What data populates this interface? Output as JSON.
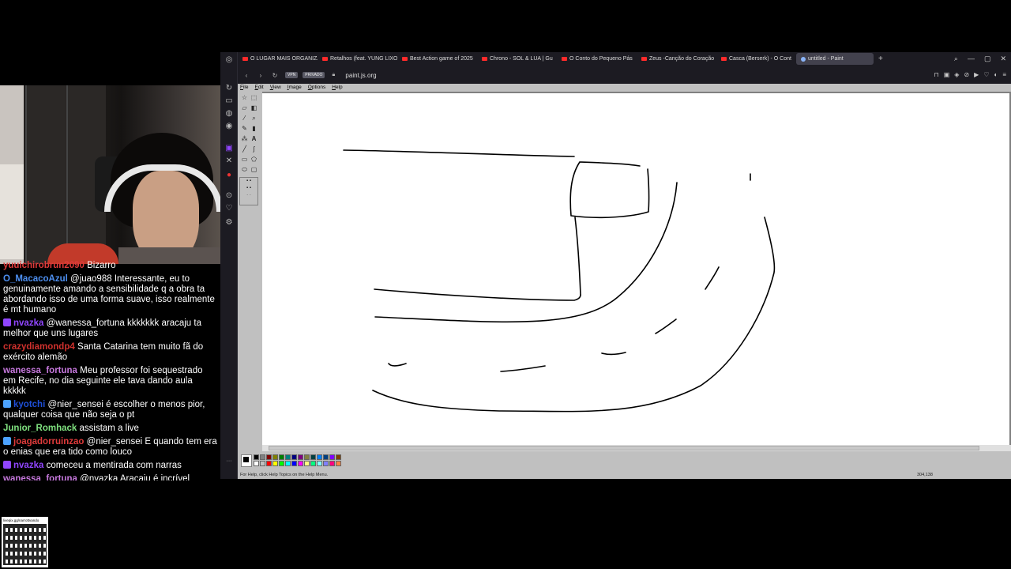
{
  "browser": {
    "tabs": [
      {
        "label": "O LUGAR MAIS ORGANIZA"
      },
      {
        "label": "Retalhos (feat. YUNG LIXO"
      },
      {
        "label": "Best Action game of 2025"
      },
      {
        "label": "Chrono - SOL & LUA | Gu"
      },
      {
        "label": "O Conto do Pequeno Pás"
      },
      {
        "label": "Zeus -Canção do Coração"
      },
      {
        "label": "Casca (Berserk) - O Cont"
      },
      {
        "label": "untitled - Paint"
      }
    ],
    "new_tab": "+",
    "vpn_label": "VPN",
    "private_label": "PRIVADO",
    "url": "paint.js.org"
  },
  "paint": {
    "menu": [
      "File",
      "Edit",
      "View",
      "Image",
      "Options",
      "Help"
    ],
    "status_text": "For Help, click Help Topics on the Help Menu.",
    "status_coords": "304,138",
    "palette": [
      "#000000",
      "#808080",
      "#800000",
      "#808000",
      "#008000",
      "#008080",
      "#000080",
      "#800080",
      "#808040",
      "#004040",
      "#0080ff",
      "#004080",
      "#8000ff",
      "#804000",
      "#ffffff",
      "#c0c0c0",
      "#ff0000",
      "#ffff00",
      "#00ff00",
      "#00ffff",
      "#0000ff",
      "#ff00ff",
      "#ffff80",
      "#00ff80",
      "#80ffff",
      "#8080ff",
      "#ff0080",
      "#ff8040"
    ]
  },
  "chat": {
    "messages": [
      {
        "user": "yuuichirobrun2090",
        "color": "#e03b3b",
        "text": "Bizarro",
        "badge": ""
      },
      {
        "user": "O_MacacoAzul",
        "color": "#4d8ff0",
        "text": "@juao988 Interessante, eu to genuinamente amando a sensibilidade q a obra ta abordando isso de uma forma suave, isso realmente é mt humano",
        "badge": ""
      },
      {
        "user": "nvazka",
        "color": "#9146ff",
        "text": "@wanessa_fortuna kkkkkkk aracaju ta melhor que uns lugares",
        "badge": "purple"
      },
      {
        "user": "crazydiamondp4",
        "color": "#d0312d",
        "text": "Santa Catarina tem muito fã do exército alemão",
        "badge": ""
      },
      {
        "user": "wanessa_fortuna",
        "color": "#c678dd",
        "text": "Meu professor foi sequestrado em Recife, no dia seguinte ele tava dando aula kkkkk",
        "badge": ""
      },
      {
        "user": "kyotchi",
        "color": "#1e4fd8",
        "text": "@nier_sensei é escolher o menos pior, qualquer coisa que não seja o pt",
        "badge": "blue"
      },
      {
        "user": "Junior_Romhack",
        "color": "#7fe07f",
        "text": "assistam a live",
        "badge": ""
      },
      {
        "user": "joagadorruinzao",
        "color": "#e03b3b",
        "text": "@nier_sensei E quando tem era o enias que era tido como louco",
        "badge": "blue"
      },
      {
        "user": "nvazka",
        "color": "#9146ff",
        "text": "comeceu a mentirada com narras",
        "badge": "purple"
      },
      {
        "user": "wanessa_fortuna",
        "color": "#c678dd",
        "text": "@nvazka Aracaju é incrível",
        "badge": ""
      }
    ]
  },
  "qr": {
    "url": "livepix.gg/narrottvando"
  }
}
